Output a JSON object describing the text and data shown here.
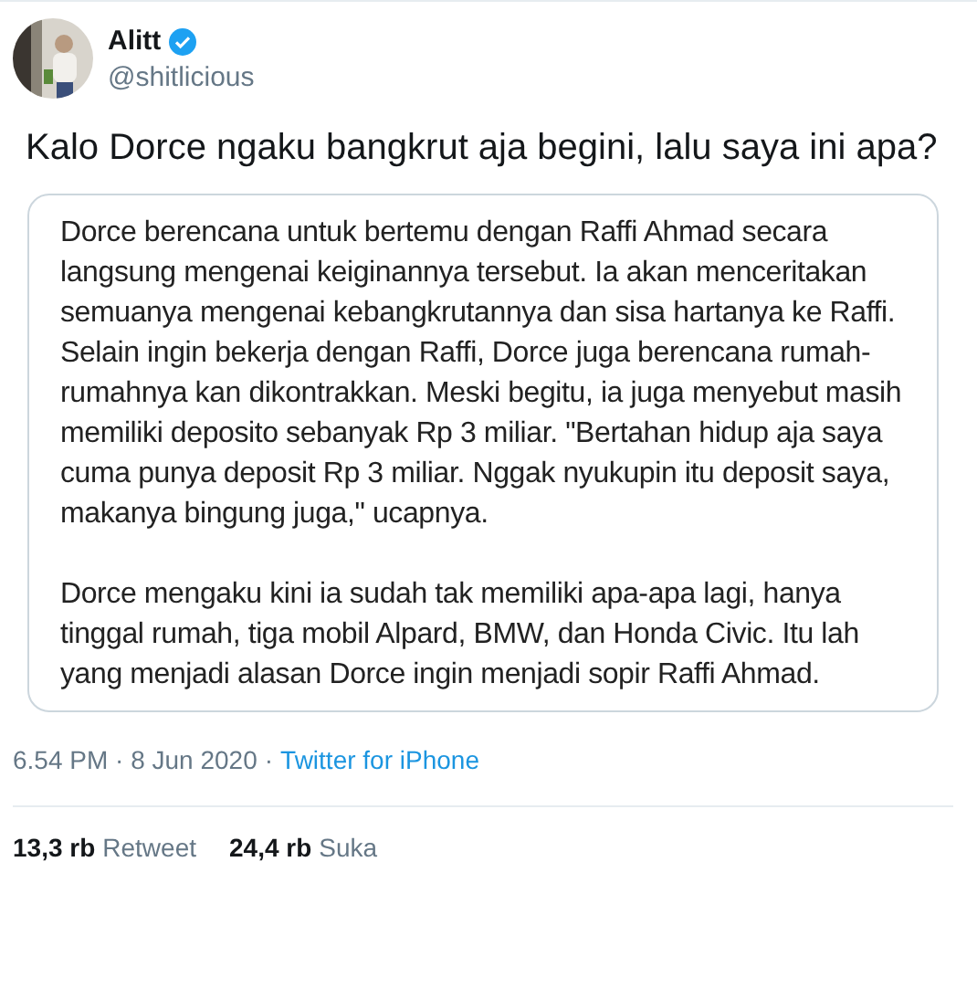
{
  "author": {
    "name": "Alitt",
    "verified": true,
    "handle": "@shitlicious"
  },
  "tweet_text": "Kalo Dorce ngaku bangkrut aja begini, lalu saya ini apa?",
  "attached_screenshot": {
    "paragraphs": [
      "Dorce berencana untuk bertemu dengan Raffi Ahmad secara langsung mengenai keiginannya tersebut. Ia akan menceritakan semuanya mengenai kebangkrutannya dan sisa hartanya ke Raffi. Selain ingin bekerja dengan Raffi, Dorce juga berencana rumah-rumahnya kan dikontrakkan. Meski begitu, ia juga menyebut masih memiliki deposito sebanyak Rp 3 miliar. \"Bertahan hidup aja saya cuma punya deposit Rp 3 miliar. Nggak nyukupin itu deposit saya, makanya bingung juga,\" ucapnya.",
      "Dorce mengaku kini ia sudah tak memiliki apa-apa lagi, hanya tinggal rumah, tiga mobil Alpard, BMW, dan Honda Civic. Itu lah yang menjadi alasan Dorce ingin menjadi sopir Raffi Ahmad."
    ]
  },
  "timestamp": "6.54 PM · 8 Jun 2020",
  "separator": "·",
  "source": "Twitter for iPhone",
  "stats": [
    {
      "count": "13,3 rb",
      "label": "Retweet"
    },
    {
      "count": "24,4 rb",
      "label": "Suka"
    }
  ]
}
